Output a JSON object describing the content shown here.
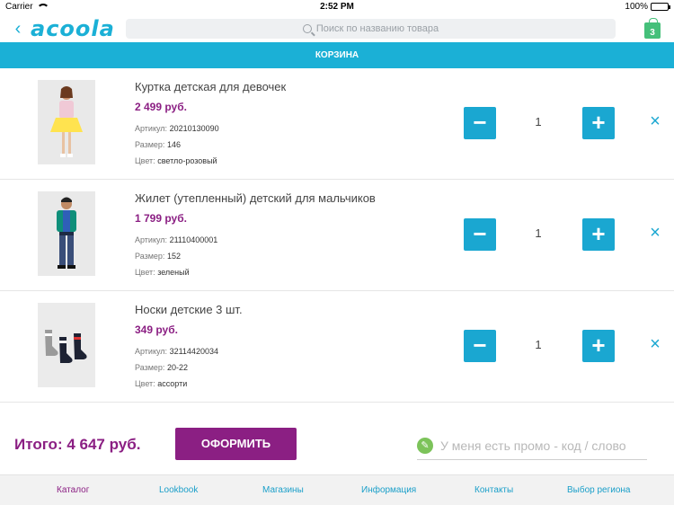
{
  "status": {
    "carrier": "Carrier",
    "time": "2:52 PM",
    "battery": "100%"
  },
  "header": {
    "logo": "acoola",
    "search_placeholder": "Поиск по названию товара",
    "cart_count": "3"
  },
  "page": {
    "title": "КОРЗИНА"
  },
  "items": [
    {
      "name": "Куртка детская для девочек",
      "price": "2 499 руб.",
      "sku_label": "Артикул:",
      "sku": "20210130090",
      "size_label": "Размер:",
      "size": "146",
      "color_label": "Цвет:",
      "color": "светло-розовый",
      "qty": "1"
    },
    {
      "name": "Жилет (утепленный) детский для мальчиков",
      "price": "1 799 руб.",
      "sku_label": "Артикул:",
      "sku": "21110400001",
      "size_label": "Размер:",
      "size": "152",
      "color_label": "Цвет:",
      "color": "зеленый",
      "qty": "1"
    },
    {
      "name": "Носки детские 3 шт.",
      "price": "349 руб.",
      "sku_label": "Артикул:",
      "sku": "32114420034",
      "size_label": "Размер:",
      "size": "20-22",
      "color_label": "Цвет:",
      "color": "ассорти",
      "qty": "1"
    }
  ],
  "summary": {
    "total": "Итого: 4 647 руб.",
    "checkout_label": "ОФОРМИТЬ",
    "promo_placeholder": "У меня есть промо - код / слово"
  },
  "nav": [
    "Каталог",
    "Lookbook",
    "Магазины",
    "Информация",
    "Контакты",
    "Выбор региона"
  ],
  "colors": {
    "accent": "#1bb0d6",
    "brand": "#8b1f83",
    "promo": "#7cc35a"
  }
}
